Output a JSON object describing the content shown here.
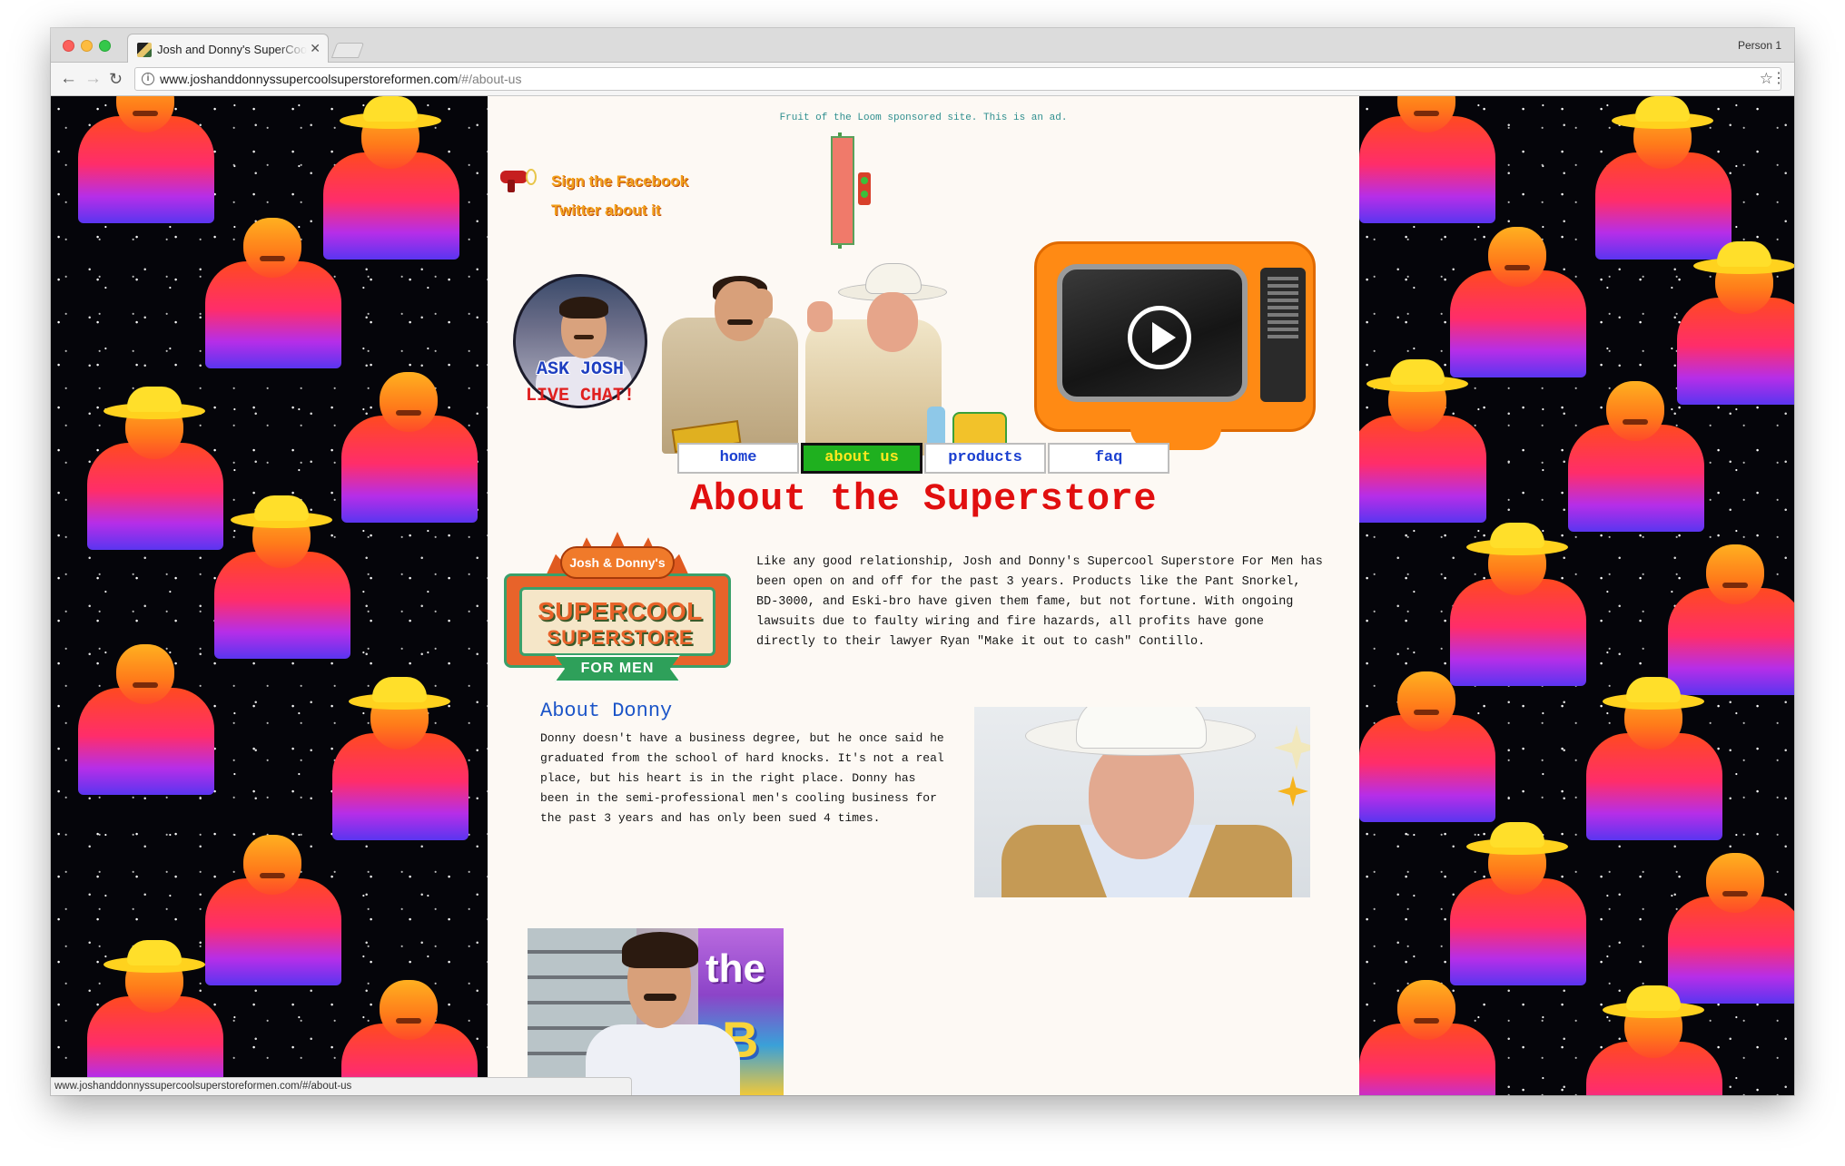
{
  "browser": {
    "tab_title": "Josh and Donny's SuperCool",
    "profile": "Person 1",
    "url_host": "www.joshanddonnyssupercoolsuperstoreformen.com",
    "url_path": "/#/about-us",
    "status_url": "www.joshanddonnyssupercoolsuperstoreformen.com/#/about-us"
  },
  "header": {
    "sponsor": "Fruit of the Loom sponsored site. This is an ad.",
    "social": {
      "facebook": "Sign the Facebook",
      "twitter": "Twitter about it"
    },
    "ask_josh": {
      "line1": "ASK JOSH",
      "line2": "LIVE CHAT!"
    }
  },
  "nav": {
    "items": [
      "home",
      "about us",
      "products",
      "faq"
    ],
    "active": "about us"
  },
  "main": {
    "title": "About the Superstore",
    "logo": {
      "top": "Josh & Donny's",
      "line1": "SUPERCOOL",
      "line2": "SUPERSTORE",
      "ribbon": "FOR MEN"
    },
    "intro": "Like any good relationship, Josh and Donny's Supercool Superstore For Men has been open on and off for the past 3 years. Products like the Pant Snorkel, BD-3000, and Eski-bro have given them fame, but not fortune. With ongoing lawsuits due to faulty wiring and fire hazards, all profits have gone directly to their lawyer Ryan \"Make it out to cash\" Contillo.",
    "donny": {
      "heading": "About Donny",
      "text": "Donny doesn't have a business degree, but he once said he graduated from the school of hard knocks. It's not a real place, but his heart is in the right place. Donny has been in the semi-professional men's cooling business for the past 3 years and has only been sued 4 times."
    },
    "josh_photo_sign": {
      "word": "the",
      "letter": "B"
    }
  }
}
